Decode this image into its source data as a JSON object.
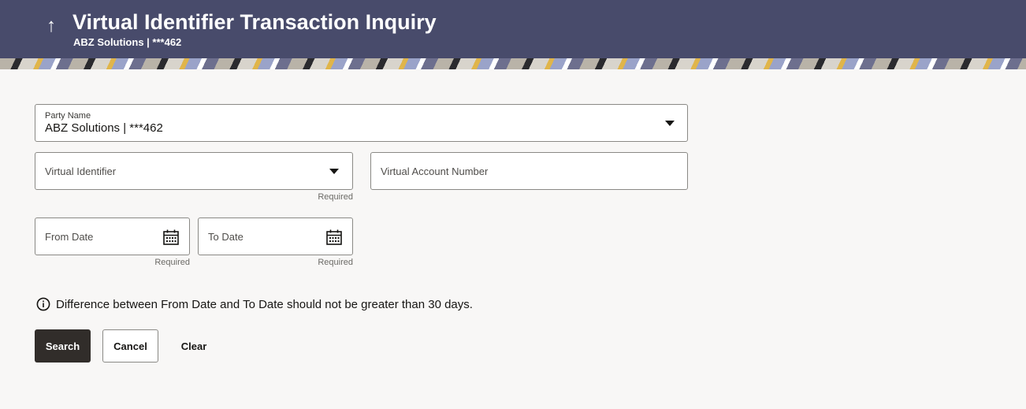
{
  "header": {
    "title": "Virtual Identifier Transaction Inquiry",
    "subtitle": "ABZ Solutions | ***462",
    "back_icon": "up-arrow-icon"
  },
  "form": {
    "party_name": {
      "label": "Party Name",
      "value": "ABZ Solutions | ***462"
    },
    "virtual_identifier": {
      "label": "Virtual Identifier",
      "helper": "Required"
    },
    "virtual_account_number": {
      "label": "Virtual Account Number"
    },
    "from_date": {
      "label": "From Date",
      "helper": "Required"
    },
    "to_date": {
      "label": "To Date",
      "helper": "Required"
    }
  },
  "info_message": "Difference between From Date and To Date should not be greater than 30 days.",
  "actions": {
    "search": "Search",
    "cancel": "Cancel",
    "clear": "Clear"
  },
  "colors": {
    "header_bg": "#484b6b",
    "page_bg": "#f8f7f6",
    "primary_button": "#312d2a"
  }
}
